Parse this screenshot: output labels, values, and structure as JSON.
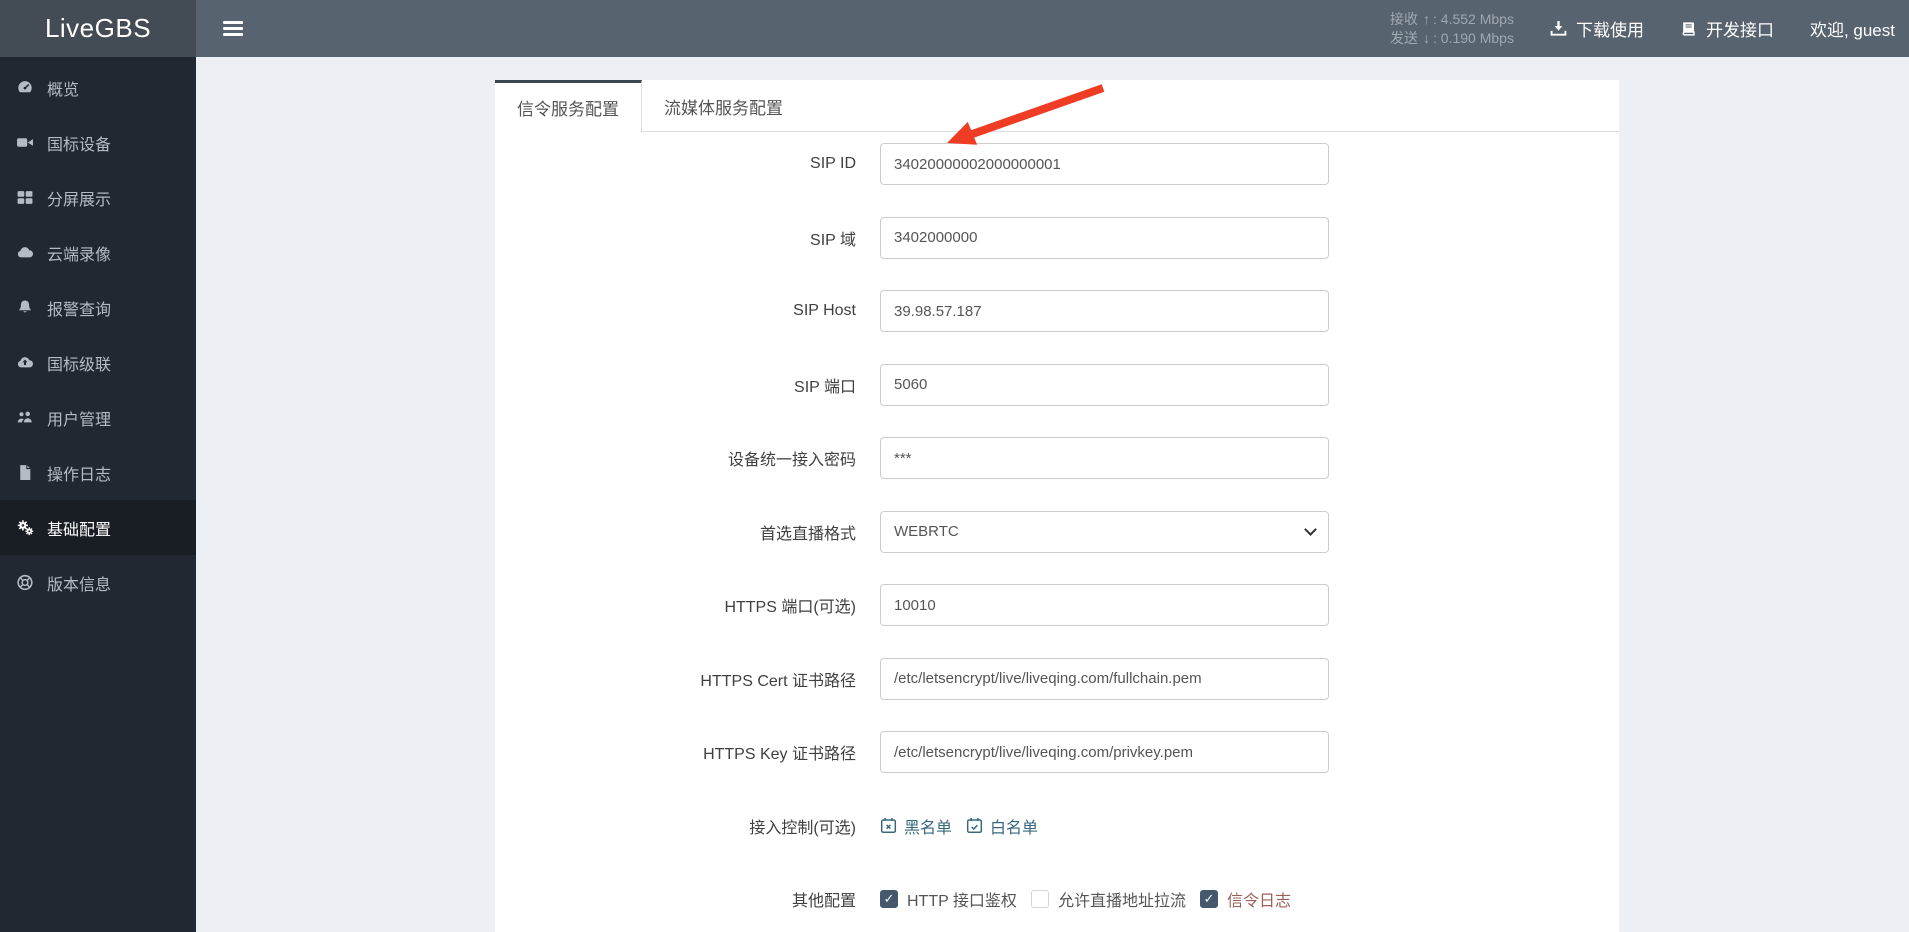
{
  "navbar": {
    "brand": "LiveGBS",
    "stats": {
      "recv_label": "接收",
      "recv_value": "4.552 Mbps",
      "send_label": "发送",
      "send_value": "0.190 Mbps"
    },
    "links": [
      {
        "id": "download-use",
        "icon": "download-icon",
        "label": "下载使用"
      },
      {
        "id": "dev-api",
        "icon": "book-icon",
        "label": "开发接口"
      },
      {
        "id": "welcome-user",
        "icon": null,
        "label": "欢迎, guest"
      }
    ]
  },
  "sidebar": {
    "items": [
      {
        "id": "overview",
        "icon": "gauge-icon",
        "label": "概览",
        "active": false
      },
      {
        "id": "gb-devices",
        "icon": "camera-icon",
        "label": "国标设备",
        "active": false
      },
      {
        "id": "split-screen",
        "icon": "grid-icon",
        "label": "分屏展示",
        "active": false
      },
      {
        "id": "cloud-recording",
        "icon": "cloud-icon",
        "label": "云端录像",
        "active": false
      },
      {
        "id": "alarm-query",
        "icon": "bell-icon",
        "label": "报警查询",
        "active": false
      },
      {
        "id": "gb-cascade",
        "icon": "cloud-upload-icon",
        "label": "国标级联",
        "active": false
      },
      {
        "id": "user-management",
        "icon": "users-icon",
        "label": "用户管理",
        "active": false
      },
      {
        "id": "operation-log",
        "icon": "file-icon",
        "label": "操作日志",
        "active": false
      },
      {
        "id": "basic-config",
        "icon": "gears-icon",
        "label": "基础配置",
        "active": true
      },
      {
        "id": "version-info",
        "icon": "lifering-icon",
        "label": "版本信息",
        "active": false
      }
    ]
  },
  "tabs": [
    {
      "id": "signal-service-config",
      "label": "信令服务配置",
      "active": true
    },
    {
      "id": "media-service-config",
      "label": "流媒体服务配置",
      "active": false
    }
  ],
  "form": {
    "rows": [
      {
        "id": "sip-id",
        "label": "SIP ID",
        "type": "input",
        "value": "34020000002000000001"
      },
      {
        "id": "sip-domain",
        "label": "SIP 域",
        "type": "input",
        "value": "3402000000"
      },
      {
        "id": "sip-host",
        "label": "SIP Host",
        "type": "input",
        "value": "39.98.57.187"
      },
      {
        "id": "sip-port",
        "label": "SIP 端口",
        "type": "input",
        "value": "5060"
      },
      {
        "id": "device-password",
        "label": "设备统一接入密码",
        "type": "input",
        "value": "***"
      },
      {
        "id": "preferred-live-format",
        "label": "首选直播格式",
        "type": "select",
        "value": "WEBRTC"
      },
      {
        "id": "https-port",
        "label": "HTTPS 端口(可选)",
        "type": "input",
        "value": "10010"
      },
      {
        "id": "https-cert-path",
        "label": "HTTPS Cert 证书路径",
        "type": "input",
        "value": "/etc/letsencrypt/live/liveqing.com/fullchain.pem"
      },
      {
        "id": "https-key-path",
        "label": "HTTPS Key 证书路径",
        "type": "input",
        "value": "/etc/letsencrypt/live/liveqing.com/privkey.pem"
      },
      {
        "id": "access-control",
        "label": "接入控制(可选)",
        "type": "links",
        "links": [
          {
            "id": "blacklist",
            "icon": "calendar-x-icon",
            "label": "黑名单"
          },
          {
            "id": "whitelist",
            "icon": "calendar-check-icon",
            "label": "白名单"
          }
        ]
      },
      {
        "id": "other-config",
        "label": "其他配置",
        "type": "checkboxes",
        "checkboxes": [
          {
            "id": "http-api-auth",
            "label": "HTTP 接口鉴权",
            "checked": true,
            "red": false
          },
          {
            "id": "allow-pull-stream",
            "label": "允许直播地址拉流",
            "checked": false,
            "red": false
          },
          {
            "id": "signal-log",
            "label": "信令日志",
            "checked": true,
            "red": true
          }
        ]
      }
    ]
  },
  "colors": {
    "page_bg": "#eceff3",
    "navbar_bg": "#57636f",
    "logo_bg": "#434c54",
    "sidebar_bg": "#222831",
    "sidebar_active_bg": "#191e24",
    "tab_active_border": "#3c4651",
    "link_blue": "#38687e",
    "link_red": "#9c5f58",
    "checkbox_checked_bg": "#45586c",
    "stats_muted": "#9fa9b2",
    "arrow_red": "#ef3c25"
  }
}
